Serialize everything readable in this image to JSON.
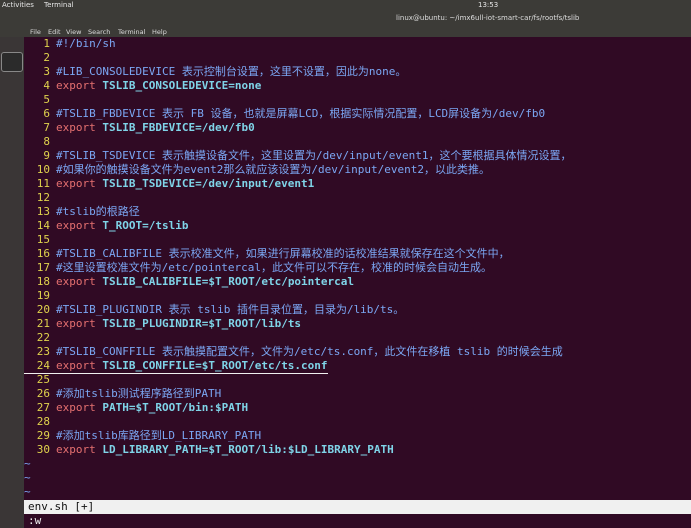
{
  "topbar": {
    "activities": "Activities",
    "app_menu": "Terminal",
    "clock": "13:53"
  },
  "window": {
    "title": "linux@ubuntu: ~/imx6ull-iot-smart-car/fs/rootfs/tslib"
  },
  "menubar": {
    "items": [
      "File",
      "Edit",
      "View",
      "Search",
      "Terminal",
      "Help"
    ]
  },
  "editor": {
    "lines": [
      {
        "num": "1",
        "type": "comment",
        "text": "#!/bin/sh"
      },
      {
        "num": "2",
        "type": "blank",
        "text": ""
      },
      {
        "num": "3",
        "type": "comment",
        "text": "#LIB_CONSOLEDEVICE 表示控制台设置，这里不设置，因此为none。"
      },
      {
        "num": "4",
        "type": "export",
        "kw": "export",
        "name": "TSLIB_CONSOLEDEVICE=none",
        "value": ""
      },
      {
        "num": "5",
        "type": "blank",
        "text": ""
      },
      {
        "num": "6",
        "type": "comment",
        "text": "#TSLIB_FBDEVICE 表示 FB 设备，也就是屏幕LCD，根据实际情况配置，LCD屏设备为/dev/fb0"
      },
      {
        "num": "7",
        "type": "export",
        "kw": "export",
        "name": "TSLIB_FBDEVICE=/dev/fb0",
        "value": ""
      },
      {
        "num": "8",
        "type": "blank",
        "text": ""
      },
      {
        "num": "9",
        "type": "comment",
        "text": "#TSLIB_TSDEVICE 表示触摸设备文件，这里设置为/dev/input/event1，这个要根据具体情况设置，"
      },
      {
        "num": "10",
        "type": "comment",
        "text": "#如果你的触摸设备文件为event2那么就应该设置为/dev/input/event2，以此类推。"
      },
      {
        "num": "11",
        "type": "export",
        "kw": "export",
        "name": "TSLIB_TSDEVICE=/dev/input/event1",
        "value": ""
      },
      {
        "num": "12",
        "type": "blank",
        "text": ""
      },
      {
        "num": "13",
        "type": "comment",
        "text": "#tslib的根路径"
      },
      {
        "num": "14",
        "type": "export",
        "kw": "export",
        "name": "T_ROOT=/tslib",
        "value": ""
      },
      {
        "num": "15",
        "type": "blank",
        "text": ""
      },
      {
        "num": "16",
        "type": "comment",
        "text": "#TSLIB_CALIBFILE 表示校准文件，如果进行屏幕校准的话校准结果就保存在这个文件中，"
      },
      {
        "num": "17",
        "type": "comment",
        "text": "#这里设置校准文件为/etc/pointercal，此文件可以不存在，校准的时候会自动生成。"
      },
      {
        "num": "18",
        "type": "export",
        "kw": "export",
        "name": "TSLIB_CALIBFILE=",
        "value": "$T_ROOT/etc/pointercal"
      },
      {
        "num": "19",
        "type": "blank",
        "text": ""
      },
      {
        "num": "20",
        "type": "comment",
        "text": "#TSLIB_PLUGINDIR 表示 tslib 插件目录位置，目录为/lib/ts。"
      },
      {
        "num": "21",
        "type": "export",
        "kw": "export",
        "name": "TSLIB_PLUGINDIR=",
        "value": "$T_ROOT/lib/ts"
      },
      {
        "num": "22",
        "type": "blank",
        "text": ""
      },
      {
        "num": "23",
        "type": "comment",
        "text": "#TSLIB_CONFFILE 表示触摸配置文件，文件为/etc/ts.conf，此文件在移植 tslib 的时候会生成"
      },
      {
        "num": "24",
        "type": "export",
        "kw": "export",
        "name": "TSLIB_CONFFILE=",
        "value": "$T_ROOT/etc/ts.conf",
        "cursorline": true
      },
      {
        "num": "25",
        "type": "blank",
        "text": ""
      },
      {
        "num": "26",
        "type": "comment",
        "text": "#添加tslib测试程序路径到PATH"
      },
      {
        "num": "27",
        "type": "export",
        "kw": "export",
        "name": "PATH=",
        "value": "$T_ROOT/bin:$PATH"
      },
      {
        "num": "28",
        "type": "blank",
        "text": ""
      },
      {
        "num": "29",
        "type": "comment",
        "text": "#添加tslib库路径到LD_LIBRARY_PATH"
      },
      {
        "num": "30",
        "type": "export",
        "kw": "export",
        "name": "LD_LIBRARY_PATH=",
        "value": "$T_ROOT/lib:$LD_LIBRARY_PATH"
      },
      {
        "num": "",
        "type": "tilde",
        "text": "~"
      },
      {
        "num": "",
        "type": "tilde",
        "text": "~"
      },
      {
        "num": "",
        "type": "tilde",
        "text": "~"
      }
    ]
  },
  "statusline": {
    "text": "env.sh [+]"
  },
  "cmdline": {
    "text": ":w"
  },
  "colors": {
    "background": "#300a24",
    "line_number": "#e0d34d",
    "comment": "#7ba7f4",
    "keyword": "#e57070",
    "variable": "#7fd4e8"
  }
}
